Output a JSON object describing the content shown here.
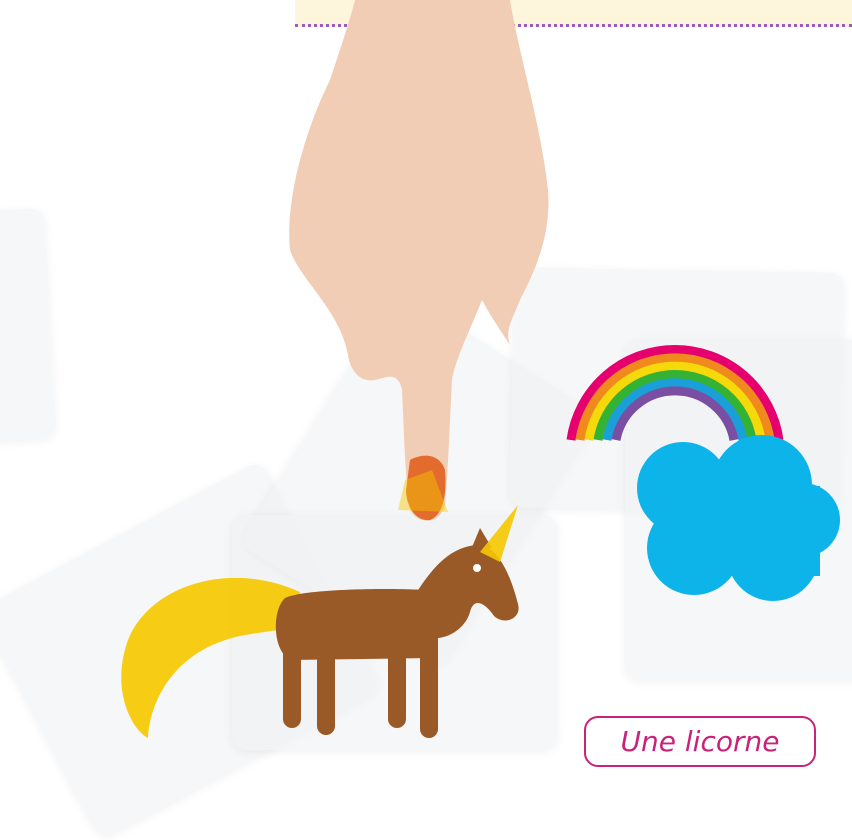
{
  "label": {
    "text": "Une licorne"
  },
  "colors": {
    "banner_bg": "#fdf6dc",
    "banner_dots": "#9b5bb8",
    "label_accent": "#c8237a",
    "unicorn_body": "#9a5a28",
    "unicorn_tail_horn": "#f5c800",
    "cloud": "#0db4ea",
    "rainbow": [
      "#e6006f",
      "#f08a1d",
      "#f5d90a",
      "#34b233",
      "#1a9fd9",
      "#7a4ea3"
    ],
    "skin": "#f2cdb6",
    "nail": "#e0601e"
  },
  "icons": [
    "unicorn-icon",
    "rainbow-icon",
    "cloud-icon",
    "hand-icon"
  ]
}
